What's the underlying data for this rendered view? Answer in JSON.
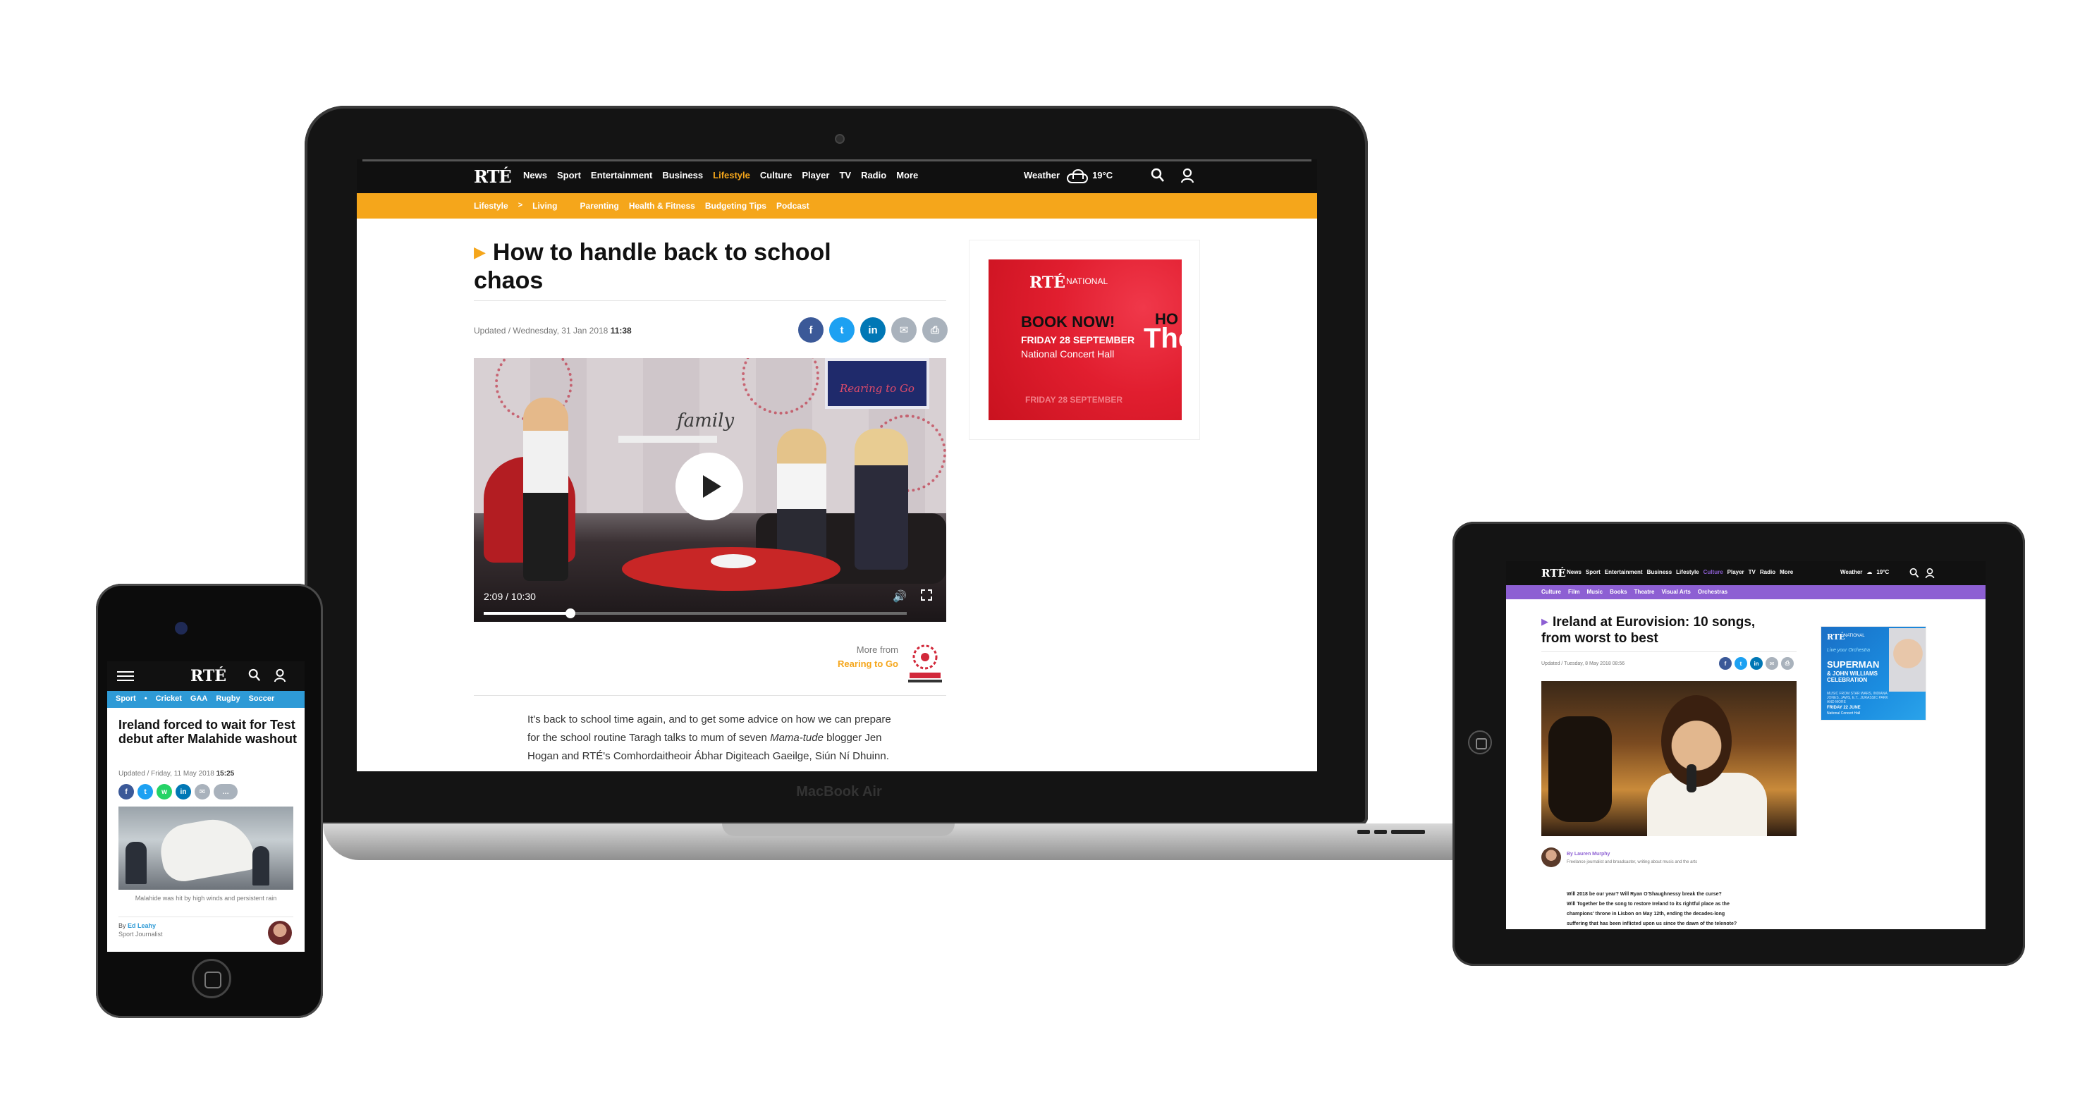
{
  "colors": {
    "rte_black": "#101010",
    "lifestyle_orange": "#f5a61b",
    "sport_blue": "#2e9ad6",
    "culture_purple": "#8d5fd3",
    "facebook": "#3b5998",
    "twitter": "#1da1f2",
    "linkedin": "#0077b5",
    "whatsapp": "#25d366",
    "share_grey": "#a9b2bc",
    "ad_red": "#e11e2f",
    "ad_blue": "#1b8de0"
  },
  "laptop": {
    "brand": "MacBook Air",
    "site": {
      "logo": "RTÉ",
      "nav": [
        "News",
        "Sport",
        "Entertainment",
        "Business",
        "Lifestyle",
        "Culture",
        "Player",
        "TV",
        "Radio",
        "More"
      ],
      "active_nav": "Lifestyle",
      "weather_label": "Weather",
      "weather_temp": "19°C",
      "weather_icon": "cloud-icon",
      "subnav": {
        "section": "Lifestyle",
        "separator": ">",
        "current": "Living",
        "items": [
          "Parenting",
          "Health & Fitness",
          "Budgeting Tips",
          "Podcast"
        ]
      },
      "article": {
        "headline": "How to handle back to school chaos",
        "updated_prefix": "Updated / Wednesday, 31 Jan 2018",
        "updated_time": "11:38",
        "share_icons": [
          "facebook-icon",
          "twitter-icon",
          "linkedin-icon",
          "email-icon",
          "print-icon"
        ],
        "video": {
          "sign_text": "Rearing to Go",
          "set_word": "family",
          "time": "2:09 / 10:30",
          "progress_fraction": 0.205
        },
        "more_from_label": "More from",
        "more_from_name": "Rearing to Go",
        "body_line1": "It's back to school time again, and to get some advice on how we can prepare",
        "body_line2_pre": "for the school routine Taragh talks to mum of seven ",
        "body_line2_em": "Mama-tude",
        "body_line2_post": " blogger Jen",
        "body_line3": "Hogan and RTÉ's Comhordaitheoir Ábhar Digiteach Gaeilge, Siún Ní Dhuinn."
      },
      "ad": {
        "logo": "RTÉ",
        "org": "NATIONAL",
        "book": "BOOK NOW!",
        "date": "FRIDAY 28 SEPTEMBER",
        "venue": "National Concert Hall",
        "cut_title": "The",
        "cut_title2": "HO",
        "faded_date": "FRIDAY 28 SEPTEMBER"
      }
    }
  },
  "phone": {
    "logo": "RTÉ",
    "subnav": [
      "Sport",
      "•",
      "Cricket",
      "GAA",
      "Rugby",
      "Soccer"
    ],
    "headline": "Ireland forced to wait for Test debut after Malahide washout",
    "updated_prefix": "Updated / Friday, 11 May 2018",
    "updated_time": "15:25",
    "share_icons": [
      "facebook-icon",
      "twitter-icon",
      "whatsapp-icon",
      "linkedin-icon",
      "email-icon",
      "comments-icon"
    ],
    "caption": "Malahide was hit by high winds and persistent rain",
    "byline_prefix": "By",
    "byline_name": "Ed Leahy",
    "byline_role": "Sport Journalist"
  },
  "tablet": {
    "logo": "RTÉ",
    "nav": [
      "News",
      "Sport",
      "Entertainment",
      "Business",
      "Lifestyle",
      "Culture",
      "Player",
      "TV",
      "Radio",
      "More"
    ],
    "active_nav": "Culture",
    "weather_label": "Weather",
    "weather_temp": "19°C",
    "subnav": [
      "Culture",
      "Film",
      "Music",
      "Books",
      "Theatre",
      "Visual Arts",
      "Orchestras"
    ],
    "headline": "Ireland at Eurovision: 10 songs, from worst to best",
    "updated": "Updated / Tuesday, 8 May 2018 08:56",
    "share_icons": [
      "facebook-icon",
      "twitter-icon",
      "linkedin-icon",
      "email-icon",
      "print-icon"
    ],
    "byline": "By Lauren Murphy",
    "bio": "Freelance journalist and broadcaster, writing about music and the arts",
    "body_lines": [
      "Will 2018 be our year? Will Ryan O'Shaughnessy break the curse?",
      "Will Together be the song to restore Ireland to its rightful place as the",
      "champions' throne in Lisbon on May 12th, ending the decades-long",
      "suffering that has been inflicted upon us since the dawn of the telenote?"
    ],
    "ad": {
      "logo": "RTÉ",
      "org": "NATIONAL",
      "tagline": "Live your Orchestra",
      "title": "SUPERMAN",
      "title2": "& JOHN WILLIAMS CELEBRATION",
      "fine": "MUSIC FROM STAR WARS, INDIANA JONES, JAWS, E.T., JURASSIC PARK AND MORE",
      "date": "FRIDAY 22 JUNE",
      "venue": "National Concert Hall"
    }
  }
}
